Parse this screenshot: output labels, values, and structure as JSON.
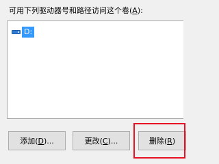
{
  "header": {
    "label_text": "可用下列驱动器号和路径访问这个卷(",
    "label_accel": "A",
    "label_end": "):"
  },
  "listbox": {
    "items": [
      {
        "icon": "drive-icon",
        "text": "D:",
        "selected": true
      }
    ]
  },
  "buttons": {
    "add": {
      "text": "添加(",
      "accel": "D",
      "end": ")..."
    },
    "change": {
      "text": "更改(",
      "accel": "C",
      "end": ")..."
    },
    "delete": {
      "text": "删除(",
      "accel": "R",
      "end": ")"
    }
  },
  "colors": {
    "selection": "#3399ff",
    "highlight_border": "#e81123",
    "drive_icon": "#2f7bd6"
  }
}
